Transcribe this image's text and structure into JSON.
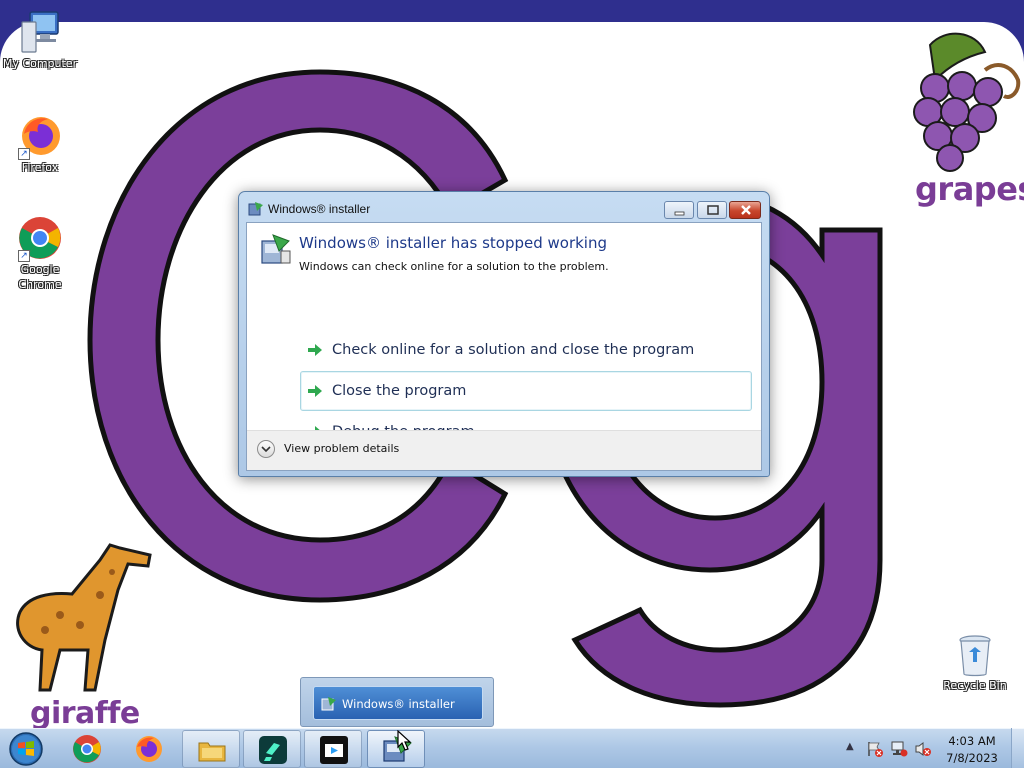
{
  "desktop": {
    "wallpaper_words": {
      "grapes": "grapes",
      "giraffe": "giraffe"
    },
    "accent_color": "#7a3d96",
    "icons": [
      {
        "label": "My Computer",
        "icon": "computer-icon"
      },
      {
        "label": "Firefox",
        "icon": "firefox-icon"
      },
      {
        "label": "Google Chrome",
        "icon": "chrome-icon"
      },
      {
        "label": "Recycle Bin",
        "icon": "recycle-bin-icon"
      }
    ]
  },
  "dialog": {
    "title": "Windows® installer",
    "heading": "Windows® installer has stopped working",
    "subtext": "Windows can check online for a solution to the problem.",
    "commands": [
      {
        "label": "Check online for a solution and close the program",
        "focused": false
      },
      {
        "label": "Close the program",
        "focused": true
      },
      {
        "label": "Debug the program",
        "focused": false
      }
    ],
    "details_label": "View problem details",
    "heading_color": "#1e3a8a"
  },
  "taskbar": {
    "thumbnail_label": "Windows® installer",
    "pinned": [
      "chrome-icon",
      "firefox-icon",
      "file-explorer-icon",
      "filmora-icon",
      "video-editor-icon",
      "installer-icon"
    ],
    "clock": {
      "time": "4:03 AM",
      "date": "7/8/2023"
    }
  }
}
